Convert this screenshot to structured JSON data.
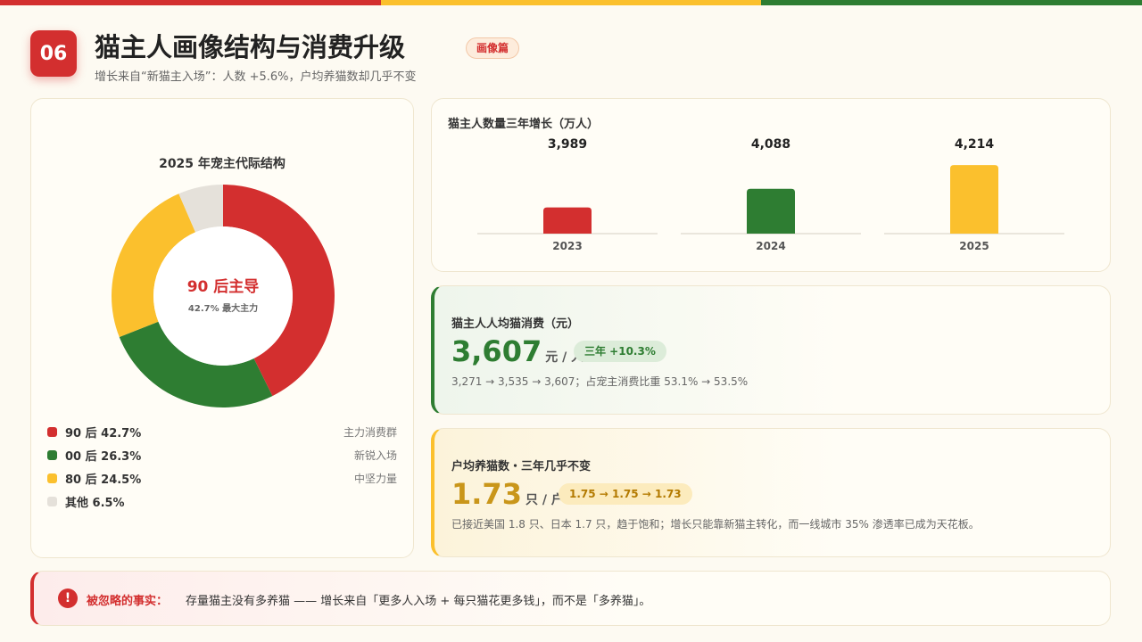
{
  "header": {
    "page_number": "06",
    "title": "猫主人画像结构与消费升级",
    "tag": "画像篇",
    "subtitle": "增长来自“新猫主入场”：人数 +5.6%，户均养猫数却几乎不变"
  },
  "colors": {
    "red": "#d32f2f",
    "green": "#2e7d32",
    "yellow": "#fbc02d",
    "gray": "#e5e1da"
  },
  "chart_data": [
    {
      "type": "pie",
      "title": "2025 年宠主代际结构",
      "center_title": "90 后主导",
      "center_subtitle": "42.7% 最大主力",
      "slices": [
        {
          "name": "90 后",
          "value": 42.7,
          "label": "90 后 42.7%",
          "note": "主力消费群",
          "color": "#d32f2f"
        },
        {
          "name": "00 后",
          "value": 26.3,
          "label": "00 后 26.3%",
          "note": "新锐入场",
          "color": "#2e7d32"
        },
        {
          "name": "80 后",
          "value": 24.5,
          "label": "80 后 24.5%",
          "note": "中坚力量",
          "color": "#fbc02d"
        },
        {
          "name": "其他",
          "value": 6.5,
          "label": "其他 6.5%",
          "note": "",
          "color": "#e5e1da"
        }
      ]
    },
    {
      "type": "bar",
      "title": "猫主人数量三年增长（万人）",
      "categories": [
        "2023",
        "2024",
        "2025"
      ],
      "values": [
        3989,
        4088,
        4214
      ],
      "value_labels": [
        "3,989",
        "4,088",
        "4,214"
      ],
      "colors": [
        "#d32f2f",
        "#2e7d32",
        "#fbc02d"
      ],
      "ylim": [
        3850,
        4300
      ]
    }
  ],
  "spend": {
    "label": "猫主人人均猫消费（元）",
    "value": "3,607",
    "unit": "元 / 人",
    "badge": "三年 +10.3%",
    "note": "3,271 → 3,535 → 3,607；占宠主消费比重 53.1% → 53.5%"
  },
  "cats": {
    "label": "户均养猫数・三年几乎不变",
    "value": "1.73",
    "unit": "只 / 户",
    "badge": "1.75 → 1.75 → 1.73",
    "note": "已接近美国 1.8 只、日本 1.7 只，趋于饱和；增长只能靠新猫主转化，而一线城市 35% 渗透率已成为天花板。"
  },
  "footer": {
    "icon": "!",
    "label": "被忽略的事实：",
    "text": "存量猫主没有多养猫 —— 增长来自「更多人入场 + 每只猫花更多钱」，而不是「多养猫」。"
  }
}
